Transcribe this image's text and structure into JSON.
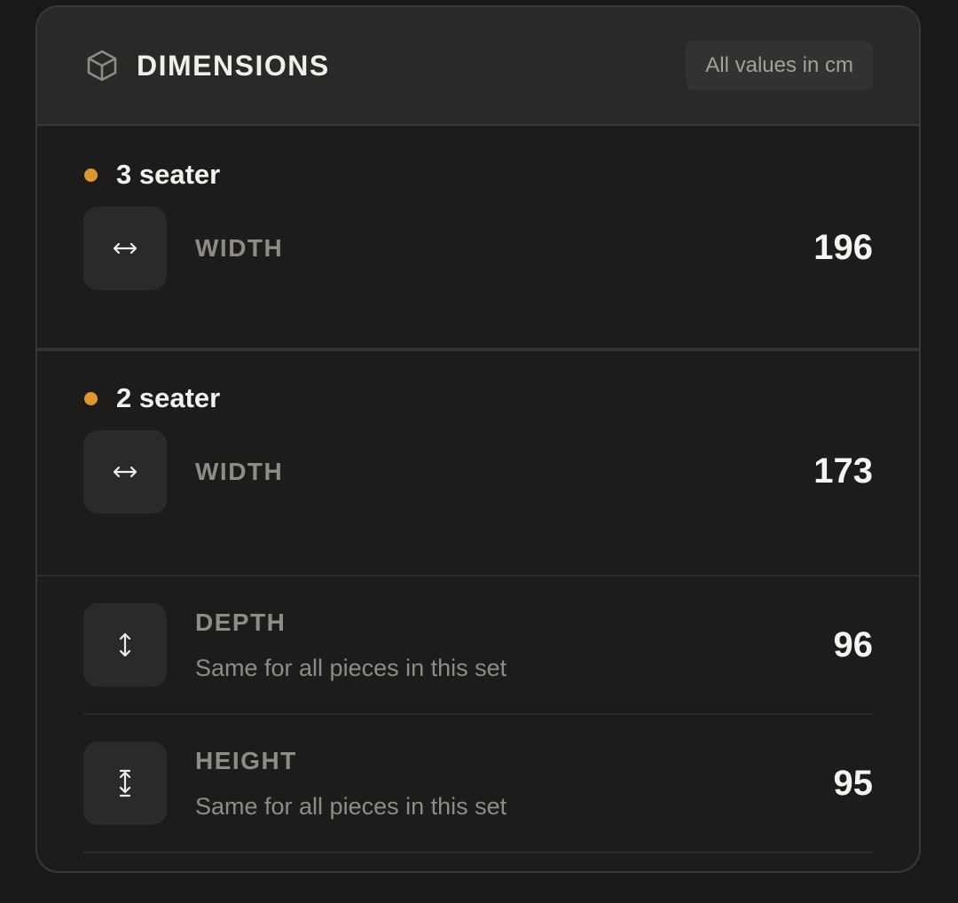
{
  "header": {
    "title": "DIMENSIONS",
    "icon": "cube-icon",
    "units_badge": "All values in cm"
  },
  "colors": {
    "accent": "#e0982e",
    "background": "#1d1c1b",
    "header_background": "#2a2927"
  },
  "sections": [
    {
      "name": "3 seater",
      "rows": [
        {
          "label": "WIDTH",
          "value": "196",
          "icon": "horizontal-arrows-icon"
        }
      ]
    },
    {
      "name": "2 seater",
      "rows": [
        {
          "label": "WIDTH",
          "value": "173",
          "icon": "horizontal-arrows-icon"
        }
      ]
    }
  ],
  "shared": [
    {
      "label": "DEPTH",
      "note": "Same for all pieces in this set",
      "value": "96",
      "icon": "vertical-arrows-icon"
    },
    {
      "label": "HEIGHT",
      "note": "Same for all pieces in this set",
      "value": "95",
      "icon": "height-arrows-icon"
    }
  ]
}
